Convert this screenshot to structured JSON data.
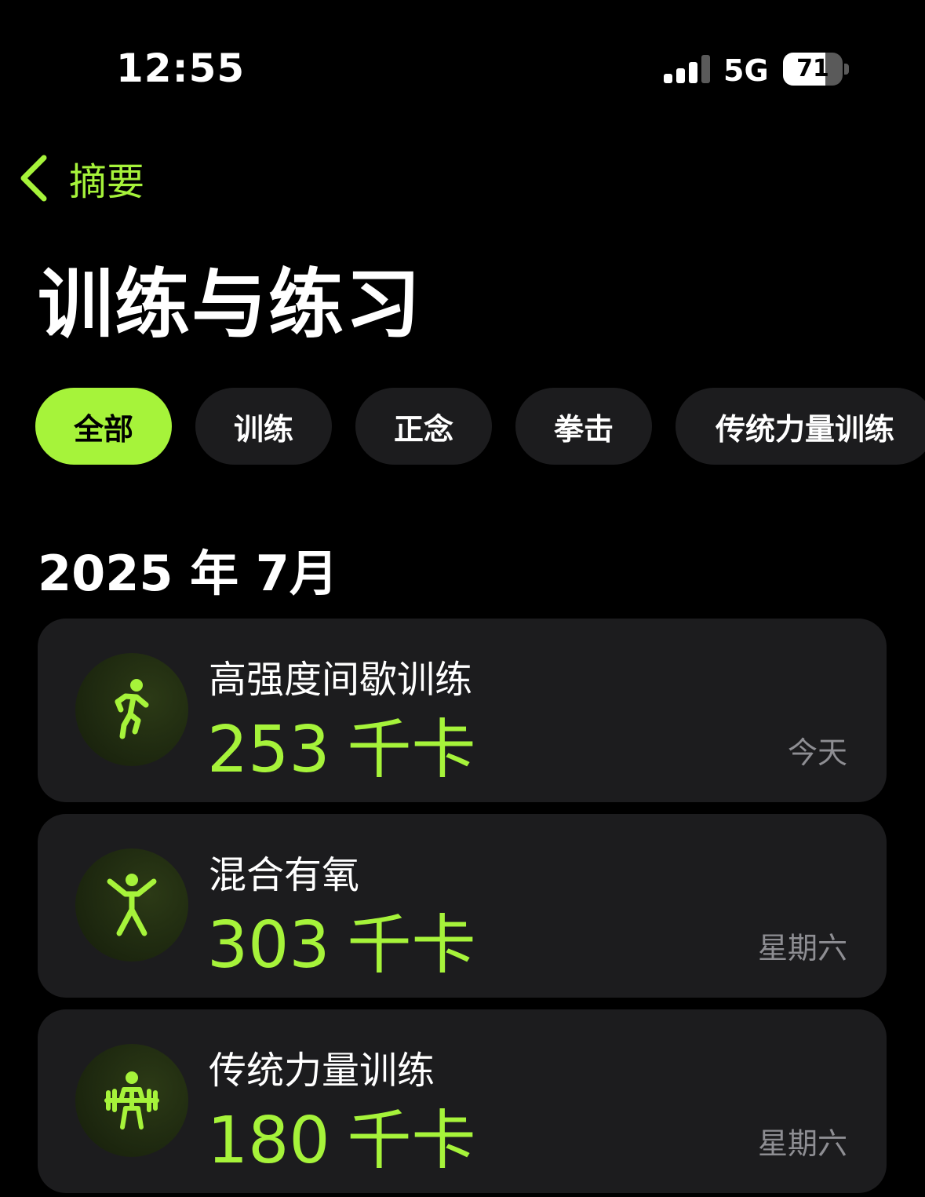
{
  "status_bar": {
    "time": "12:55",
    "network": "5G",
    "battery_percent": "71",
    "signal_bars": 4
  },
  "nav": {
    "back_label": "摘要"
  },
  "title": "训练与练习",
  "filters": [
    {
      "label": "全部",
      "active": true
    },
    {
      "label": "训练",
      "active": false
    },
    {
      "label": "正念",
      "active": false
    },
    {
      "label": "拳击",
      "active": false
    },
    {
      "label": "传统力量训练",
      "active": false
    }
  ],
  "section": {
    "header": "2025 年 7月"
  },
  "workouts": [
    {
      "name": "高强度间歇训练",
      "calories": "253",
      "unit": "千卡",
      "date": "今天",
      "icon": "running-person-icon"
    },
    {
      "name": "混合有氧",
      "calories": "303",
      "unit": "千卡",
      "date": "星期六",
      "icon": "jumping-jack-icon"
    },
    {
      "name": "传统力量训练",
      "calories": "180",
      "unit": "千卡",
      "date": "星期六",
      "icon": "weightlifting-icon"
    }
  ],
  "colors": {
    "accent": "#a6f33a",
    "background": "#000000",
    "card": "#1c1c1e",
    "secondary_text": "#8e8e93"
  }
}
